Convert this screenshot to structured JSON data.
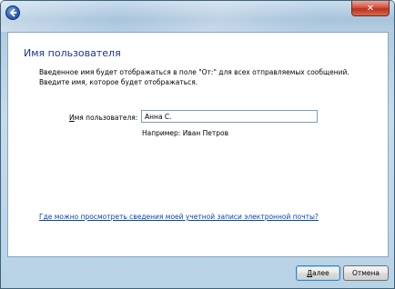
{
  "header": {
    "title": "Имя пользователя",
    "description_line1": "Введенное имя будет отображаться в поле \"От:\" для всех отправляемых сообщений.",
    "description_line2": "Введите имя, которое будет отображаться."
  },
  "form": {
    "name_label_underlined": "И",
    "name_label_rest": "мя пользователя:",
    "name_value": "Анна С.",
    "example_text": "Например: Иван Петров"
  },
  "links": {
    "account_info": "Где можно просмотреть сведения моей учетной записи электронной почты?"
  },
  "footer": {
    "next_label_underlined": "Д",
    "next_label_rest": "алее",
    "cancel_label": "Отмена"
  },
  "icons": {
    "back": "back-arrow-icon",
    "close": "close-icon"
  },
  "colors": {
    "heading": "#1e3287",
    "link": "#0645ad",
    "close_button": "#c8432f"
  }
}
